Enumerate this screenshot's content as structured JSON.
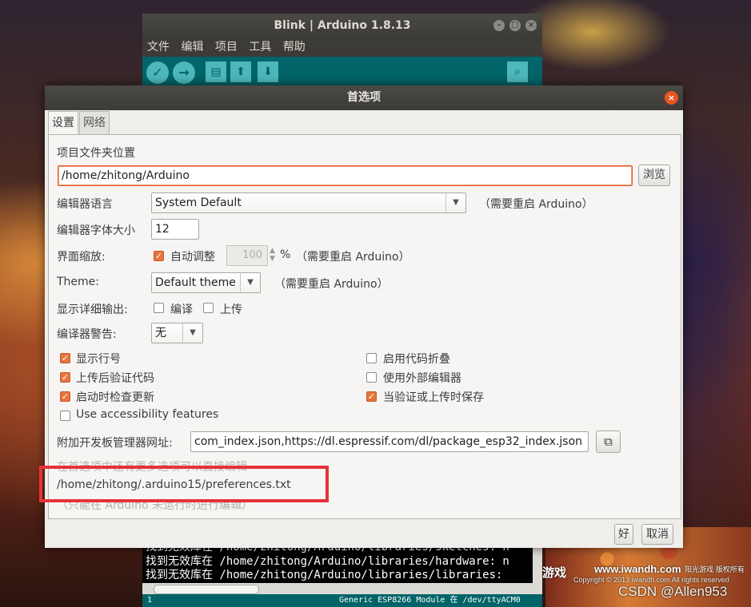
{
  "desktop": {
    "watermark_game": "游戏",
    "watermark_site": "www.iwandh.com",
    "watermark_cn": "阳光游戏 版权所有",
    "watermark_copyright": "Copyright © 2013 iwandh.com All rights reserved",
    "watermark_csdn": "CSDN @Allen953"
  },
  "arduino": {
    "title": "Blink | Arduino 1.8.13",
    "menu": [
      "文件",
      "编辑",
      "项目",
      "工具",
      "帮助"
    ],
    "toolbar_icons": [
      "verify-icon",
      "upload-icon",
      "new-icon",
      "open-icon",
      "save-icon",
      "serial-monitor-icon"
    ],
    "console_lines": [
      "找到无效库在 /home/zhitong/Arduino/libraries/sketches: n",
      "找到无效库在 /home/zhitong/Arduino/libraries/hardware: n",
      "找到无效库在 /home/zhitong/Arduino/libraries/libraries: "
    ],
    "status_line": "1",
    "status_board": "Generic ESP8266 Module 在 /dev/ttyACM0"
  },
  "prefs": {
    "title": "首选项",
    "tabs": [
      "设置",
      "网络"
    ],
    "sketchbook_label": "项目文件夹位置",
    "sketchbook_path": "/home/zhitong/Arduino",
    "browse": "浏览",
    "language_label": "编辑器语言",
    "language_value": "System Default",
    "restart_note": "（需要重启 Arduino）",
    "font_size_label": "编辑器字体大小",
    "font_size_value": "12",
    "scale_label": "界面缩放:",
    "scale_auto_label": "自动调整",
    "scale_value": "100",
    "scale_unit": "%",
    "theme_label": "Theme:",
    "theme_value": "Default theme",
    "verbose_label": "显示详细输出:",
    "verbose_compile": "编译",
    "verbose_upload": "上传",
    "warnings_label": "编译器警告:",
    "warnings_value": "无",
    "options": {
      "line_numbers": "显示行号",
      "verify_after_upload": "上传后验证代码",
      "check_updates": "启动时检查更新",
      "accessibility": "Use accessibility features",
      "code_folding": "启用代码折叠",
      "external_editor": "使用外部编辑器",
      "save_on_verify": "当验证或上传时保存"
    },
    "board_urls_label": "附加开发板管理器网址:",
    "board_urls_value": "com_index.json,https://dl.espressif.com/dl/package_esp32_index.json",
    "more_prefs_note": "在首选项中还有更多选项可以直接编辑",
    "prefs_file_path": "/home/zhitong/.arduino15/preferences.txt",
    "edit_note": "（只能在 Arduino 未运行时进行编辑）",
    "ok": "好",
    "cancel": "取消"
  }
}
